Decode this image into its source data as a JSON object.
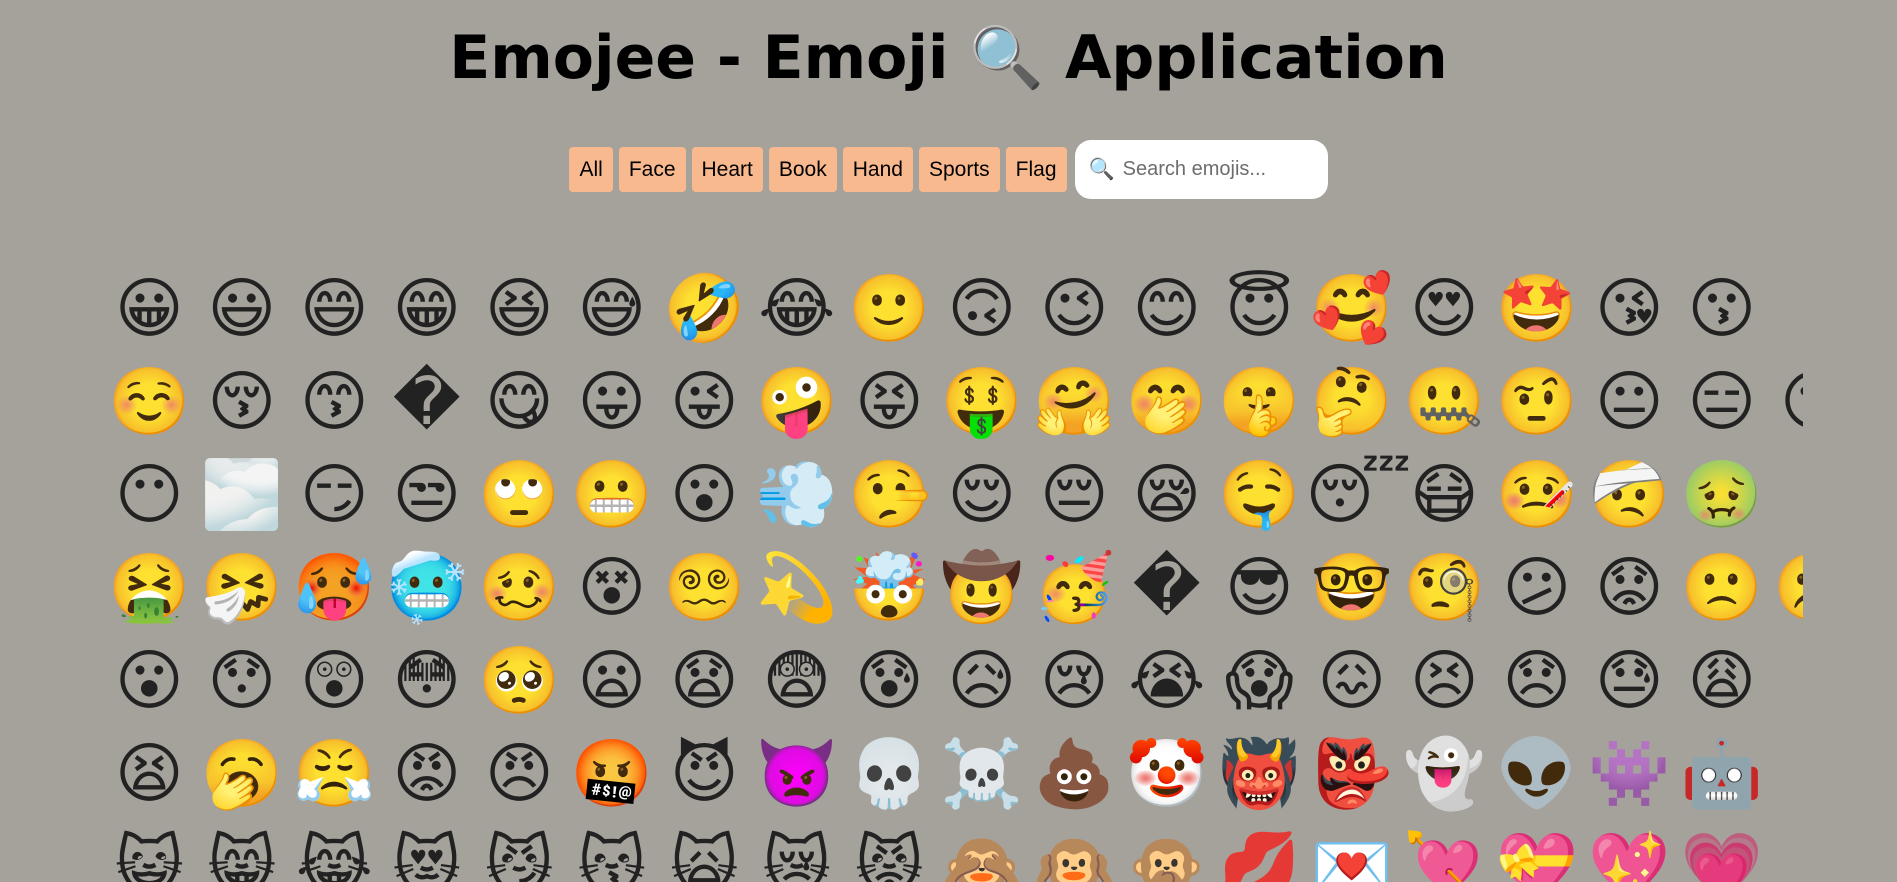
{
  "header": {
    "title": "Emojee - Emoji 🔍 Application"
  },
  "categories": [
    "All",
    "Face",
    "Heart",
    "Book",
    "Hand",
    "Sports",
    "Flag"
  ],
  "search": {
    "icon": "🔍",
    "placeholder": "Search emojis...",
    "value": ""
  },
  "emoji_rows": [
    [
      "😀",
      "😃",
      "😄",
      "😁",
      "😆",
      "😅",
      "🤣",
      "😂",
      "🙂",
      "🙃",
      "😉",
      "😊",
      "😇",
      "🥰",
      "😍",
      "🤩",
      "😘",
      "😗"
    ],
    [
      "☺️",
      "😚",
      "😙",
      "�",
      "😋",
      "😛",
      "😜",
      "🤪",
      "😝",
      "🤑",
      "🤗",
      "🤭",
      "🤫",
      "🤔",
      "🤐",
      "🤨",
      "😐",
      "😑",
      "😶"
    ],
    [
      "😶",
      "🌫️",
      "😏",
      "😒",
      "🙄",
      "😬",
      "😮",
      "💨",
      "🤥",
      "😌",
      "😔",
      "😪",
      "🤤",
      "😴",
      "😷",
      "🤒",
      "🤕",
      "🤢"
    ],
    [
      "🤮",
      "🤧",
      "🥵",
      "🥶",
      "🥴",
      "😵",
      "😵‍💫",
      "💫",
      "🤯",
      "🤠",
      "🥳",
      "�",
      "😎",
      "🤓",
      "🧐",
      "😕",
      "😟",
      "🙁",
      "☹️"
    ],
    [
      "😮",
      "😯",
      "😲",
      "😳",
      "🥺",
      "😦",
      "😧",
      "😨",
      "😰",
      "😥",
      "😢",
      "😭",
      "😱",
      "😖",
      "😣",
      "😞",
      "😓",
      "😩"
    ],
    [
      "😫",
      "🥱",
      "😤",
      "😡",
      "😠",
      "🤬",
      "😈",
      "👿",
      "💀",
      "☠️",
      "💩",
      "🤡",
      "👹",
      "👺",
      "👻",
      "👽",
      "👾",
      "🤖"
    ],
    [
      "😺",
      "😸",
      "😹",
      "😻",
      "😼",
      "😽",
      "🙀",
      "😿",
      "😾",
      "🙈",
      "🙉",
      "🙊",
      "💋",
      "💌",
      "💘",
      "💝",
      "💖",
      "💗"
    ]
  ]
}
